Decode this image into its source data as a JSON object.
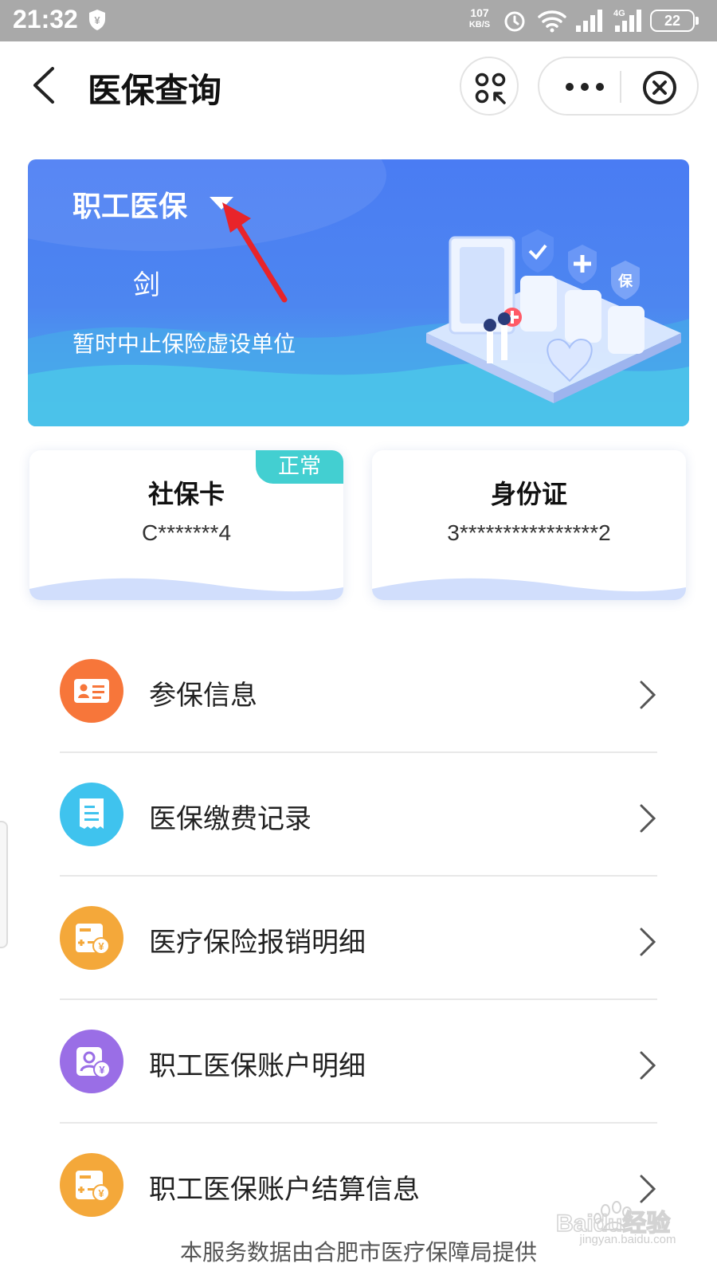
{
  "status_bar": {
    "time": "21:32",
    "net_speed": "107",
    "net_speed_unit": "KB/S",
    "network": "4G",
    "battery": "22",
    "icons": [
      "wallet-shield-icon",
      "alarm-icon",
      "wifi-icon",
      "signal-icon",
      "signal-4g-icon",
      "battery-icon"
    ]
  },
  "nav": {
    "title": "医保查询",
    "icons": [
      "back-icon",
      "scan-icon",
      "more-icon",
      "close-circle-icon"
    ]
  },
  "banner": {
    "insurance_type": "职工医保",
    "name": "剑",
    "unit": "暂时中止保险虚设单位"
  },
  "cards": {
    "social_card": {
      "title": "社保卡",
      "value": "C*******4",
      "status": "正常"
    },
    "id_card": {
      "title": "身份证",
      "value": "3****************2"
    }
  },
  "menu": [
    {
      "label": "参保信息",
      "icon": "id-card-icon",
      "color": "#f7763a"
    },
    {
      "label": "医保缴费记录",
      "icon": "receipt-icon",
      "color": "#3fc3ee"
    },
    {
      "label": "医疗保险报销明细",
      "icon": "calculator-yuan-icon",
      "color": "#f4a83a"
    },
    {
      "label": "职工医保账户明细",
      "icon": "user-yuan-icon",
      "color": "#9a6ee6"
    },
    {
      "label": "职工医保账户结算信息",
      "icon": "calculator-yuan-icon",
      "color": "#f4a83a"
    }
  ],
  "footer": "本服务数据由合肥市医疗保障局提供",
  "watermark": {
    "logo": "Baidu经验",
    "url": "jingyan.baidu.com"
  },
  "colors": {
    "banner_top": "#4a7cf3",
    "banner_bottom": "#49b6ea",
    "badge": "#43cfd1",
    "annotation_arrow": "#e8242a"
  }
}
